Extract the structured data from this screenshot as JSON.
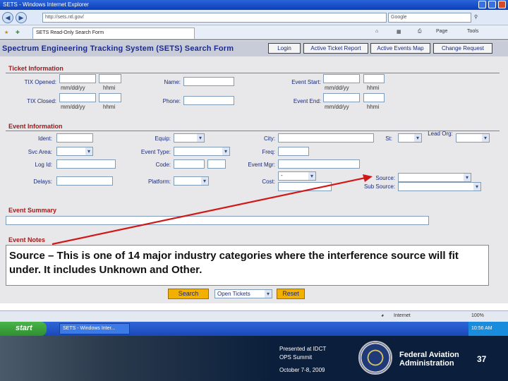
{
  "browser": {
    "window_title": "SETS - Windows Internet Explorer",
    "address": "http://sets.ntl.gov/",
    "search_placeholder": "Google",
    "tab_label": "SETS Read-Only Search Form",
    "toolbar_page": "Page",
    "toolbar_tools": "Tools"
  },
  "header": {
    "title": "Spectrum Engineering Tracking System (SETS) Search Form",
    "buttons": [
      "Login",
      "Active Ticket Report",
      "Active Events Map",
      "Change Request"
    ]
  },
  "ticket_info": {
    "section": "Ticket Information",
    "tix_opened": "TIX Opened:",
    "tix_closed": "TIX Closed:",
    "name": "Name:",
    "phone": "Phone:",
    "event_start": "Event Start:",
    "event_end": "Event End:",
    "date_hint": "mm/dd/yy",
    "time_hint": "hhmi"
  },
  "event_info": {
    "section": "Event Information",
    "ident": "Ident:",
    "equip": "Equip:",
    "city": "City:",
    "st": "St:",
    "lead_org": "Lead Org:",
    "svc_area": "Svc Area:",
    "event_type": "Event Type:",
    "freq": "Freq:",
    "log_id": "Log Id:",
    "code": "Code:",
    "event_mgr": "Event Mgr:",
    "delays": "Delays:",
    "platform": "Platform:",
    "cost": "Cost:",
    "source": "Source:",
    "sub_source": "Sub Source:",
    "cost_select": "-"
  },
  "event_summary": {
    "section": "Event Summary"
  },
  "event_notes": {
    "section": "Event Notes"
  },
  "callout": "Source – This is one of 14 major industry categories where the interference source will fit under. It includes Unknown and Other.",
  "actions": {
    "search": "Search",
    "ticket_filter": "Open Tickets",
    "reset": "Reset"
  },
  "status_bar": {
    "zone": "Internet",
    "zoom": "100%"
  },
  "taskbar": {
    "start": "start",
    "item": "SETS - Windows Inter...",
    "clock": "10:56 AM"
  },
  "slide_footer": {
    "presented_line1": "Presented at IDCT",
    "presented_line2": "OPS Summit",
    "date": "October 7-8, 2009",
    "org_line1": "Federal Aviation",
    "org_line2": "Administration",
    "page_number": "37"
  },
  "colors": {
    "banner_text": "#1c2a8c",
    "section_title": "#9a1a1a",
    "action_button": "#f2b000",
    "arrow": "#d01818",
    "footer_bg": "#0b1f3c"
  }
}
